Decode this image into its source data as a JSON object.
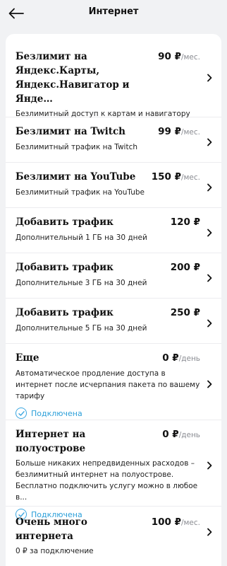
{
  "header": {
    "title": "Интернет"
  },
  "services": [
    {
      "name": "Безлимит на Яндекс.Карты, Яндекс.Навигатор и Янде…",
      "price": "90 ₽",
      "unit": "/мес.",
      "desc": "Безлимитный доступ к картам и навигатору"
    },
    {
      "name": "Безлимит на Twitch",
      "price": "99 ₽",
      "unit": "/мес.",
      "desc": "Безлимитный трафик на Twitch"
    },
    {
      "name": "Безлимит на YouTube",
      "price": "150 ₽",
      "unit": "/мес.",
      "desc": "Безлимитный трафик на YouTube"
    },
    {
      "name": "Добавить трафик",
      "price": "120 ₽",
      "unit": "",
      "desc": "Дополнительный 1 ГБ на 30 дней"
    },
    {
      "name": "Добавить трафик",
      "price": "200 ₽",
      "unit": "",
      "desc": "Дополнительные 3 ГБ на 30 дней"
    },
    {
      "name": "Добавить трафик",
      "price": "250 ₽",
      "unit": "",
      "desc": "Дополнительные 5 ГБ на 30 дней"
    },
    {
      "name": "Еще",
      "price": "0 ₽",
      "unit": "/день",
      "desc": "Автоматическое продление доступа в интернет после исчерпания пакета по вашему тарифу",
      "status": "Подключена"
    },
    {
      "name": "Интернет на полуострове",
      "price": "0 ₽",
      "unit": "/день",
      "desc": "Больше никаких непредвиденных расходов – безлимитный интернет на полуострове. Бесплатно подключить услугу можно в любое в...",
      "status": "Подключена"
    },
    {
      "name": "Очень много интернета",
      "price": "100 ₽",
      "unit": "/мес.",
      "desc": "0 ₽ за подключение"
    }
  ],
  "colors": {
    "accent": "#2b9fd9",
    "background": "#f1f2f4"
  },
  "icons": {
    "back": "arrow-left-icon",
    "chevron": "chevron-right-icon",
    "status": "check-circle-icon"
  }
}
